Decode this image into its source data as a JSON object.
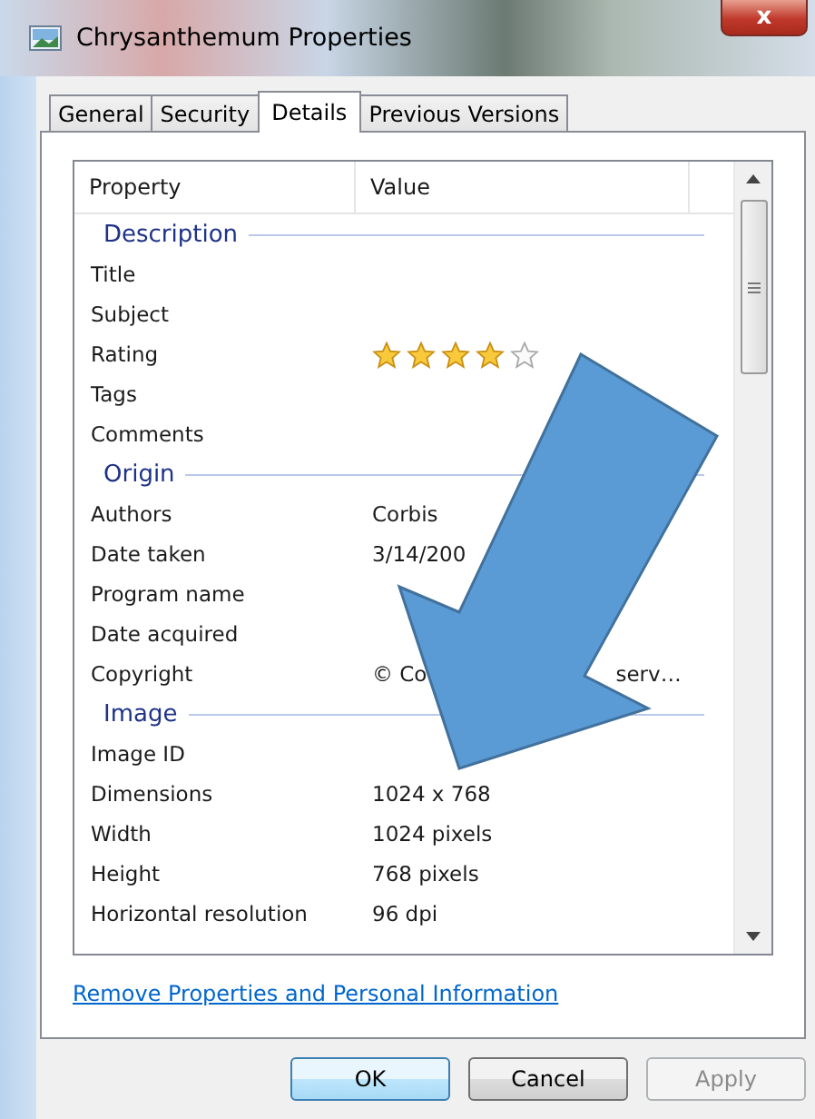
{
  "window": {
    "title": "Chrysanthemum Properties",
    "close": "x"
  },
  "tabs": [
    {
      "label": "General",
      "selected": false
    },
    {
      "label": "Security",
      "selected": false
    },
    {
      "label": "Details",
      "selected": true
    },
    {
      "label": "Previous Versions",
      "selected": false
    }
  ],
  "list": {
    "columns": [
      "Property",
      "Value"
    ],
    "groups": [
      {
        "heading": "Description",
        "items": [
          {
            "kind": "text",
            "property": "Title"
          },
          {
            "kind": "text",
            "property": "Subject"
          },
          {
            "kind": "rating",
            "property": "Rating",
            "stars": 4
          },
          {
            "kind": "text",
            "property": "Tags"
          },
          {
            "kind": "text",
            "property": "Comments"
          }
        ]
      },
      {
        "heading": "Origin",
        "items": [
          {
            "kind": "text",
            "property": "Authors",
            "value": "Corbis"
          },
          {
            "kind": "text",
            "property": "Date taken",
            "value": "3/14/200"
          },
          {
            "kind": "text",
            "property": "Program name"
          },
          {
            "kind": "text",
            "property": "Date acquired"
          },
          {
            "kind": "split",
            "property": "Copyright",
            "value": "© Co",
            "value_end": "serv…"
          }
        ]
      },
      {
        "heading": "Image",
        "items": [
          {
            "kind": "text",
            "property": "Image ID"
          },
          {
            "kind": "text",
            "property": "Dimensions",
            "value": "1024 x 768"
          },
          {
            "kind": "text",
            "property": "Width",
            "value": "1024 pixels"
          },
          {
            "kind": "text",
            "property": "Height",
            "value": "768 pixels"
          },
          {
            "kind": "text",
            "property": "Horizontal resolution",
            "value": "96 dpi"
          }
        ]
      }
    ]
  },
  "link": "Remove Properties and Personal Information",
  "buttons": [
    {
      "label": "OK",
      "default": true,
      "disabled": false
    },
    {
      "label": "Cancel",
      "default": false,
      "disabled": false
    },
    {
      "label": "Apply",
      "default": false,
      "disabled": true
    }
  ]
}
